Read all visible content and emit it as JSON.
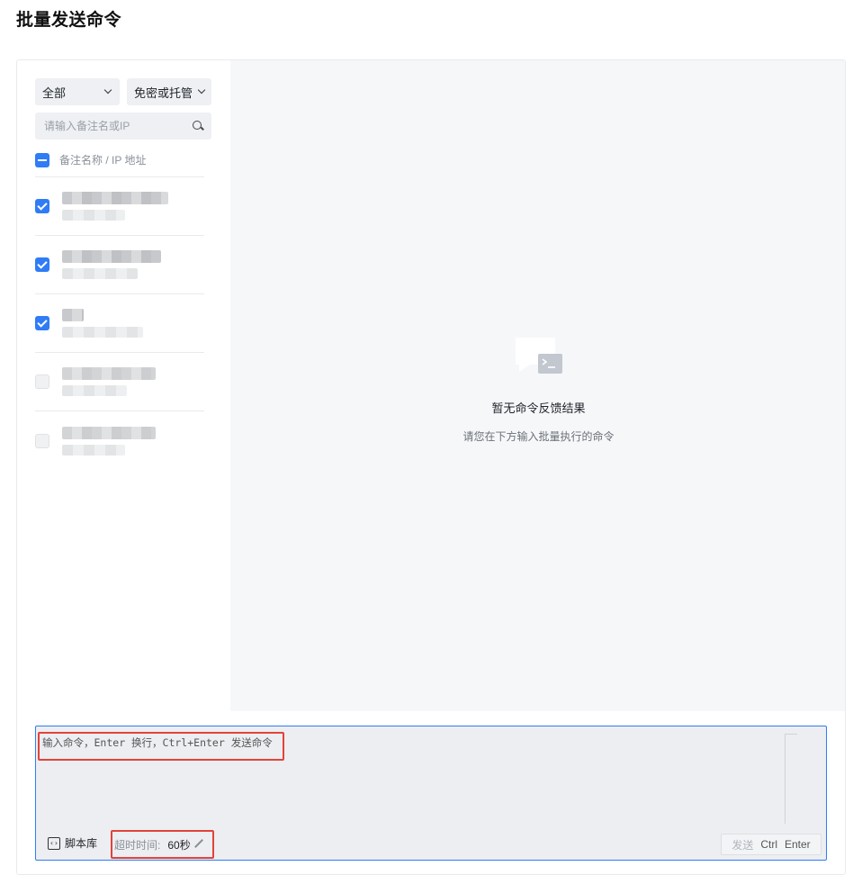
{
  "page": {
    "title": "批量发送命令"
  },
  "filters": {
    "scope": {
      "value": "全部"
    },
    "auth_type": {
      "value": "免密或托管"
    },
    "search": {
      "placeholder": "请输入备注名或IP"
    }
  },
  "server_list": {
    "header_label": "备注名称 / IP 地址",
    "items": [
      {
        "checked": true
      },
      {
        "checked": true
      },
      {
        "checked": true
      },
      {
        "checked": false
      },
      {
        "checked": false
      }
    ]
  },
  "result": {
    "empty_title": "暂无命令反馈结果",
    "empty_hint": "请您在下方输入批量执行的命令"
  },
  "command": {
    "placeholder": "输入命令，Enter 换行，Ctrl+Enter 发送命令",
    "script_library_label": "脚本库",
    "timeout_label": "超时时间:",
    "timeout_value": "60秒",
    "send_label": "发送",
    "send_shortcut_ctrl": "Ctrl",
    "send_shortcut_enter": "Enter"
  },
  "colors": {
    "accent": "#2f7cf6",
    "highlight": "#e0443a",
    "result_bg": "#f6f7f9"
  },
  "icons": [
    "chevron-down-icon",
    "search-icon",
    "checkbox-icon",
    "terminal-icon",
    "script-icon",
    "pencil-icon"
  ]
}
